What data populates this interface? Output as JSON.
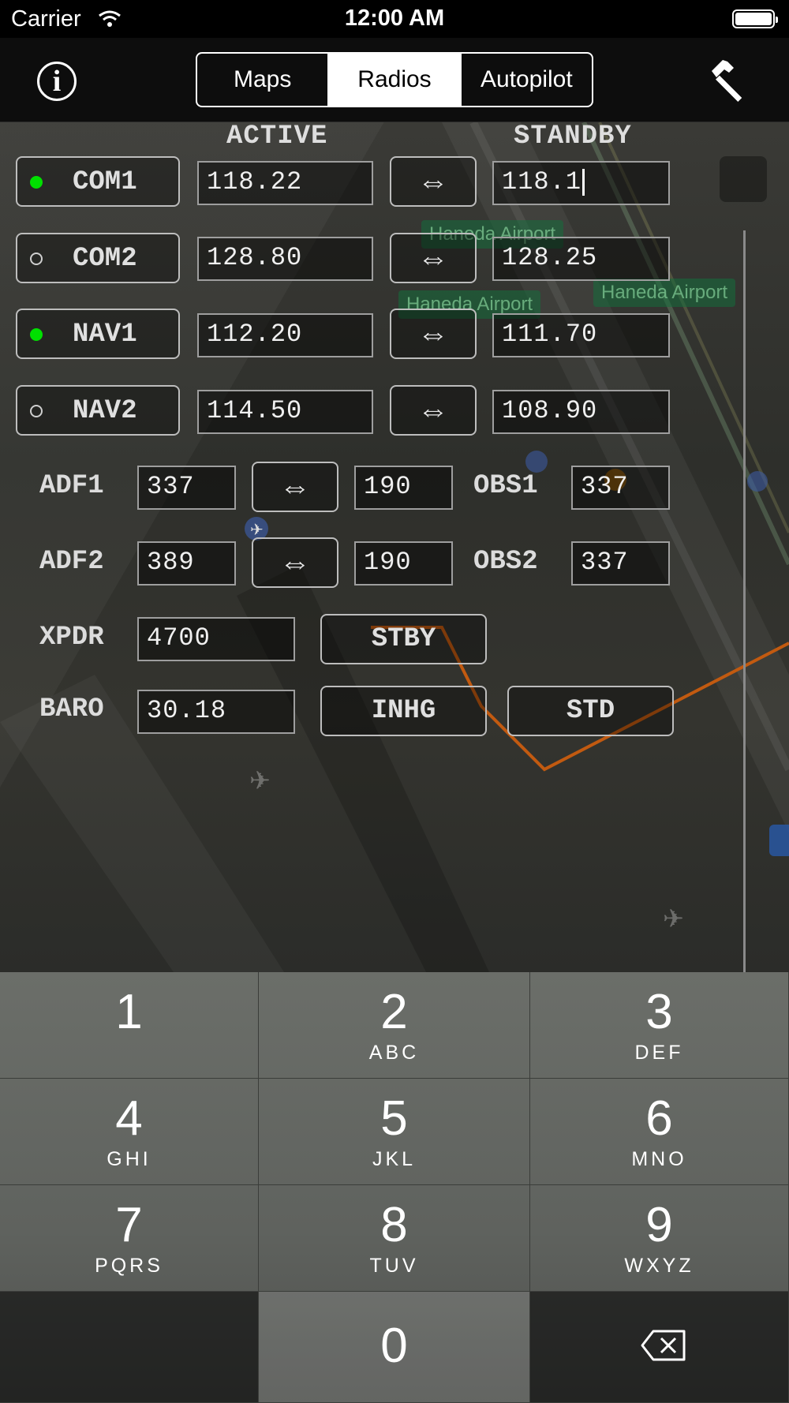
{
  "status_bar": {
    "carrier": "Carrier",
    "time": "12:00 AM"
  },
  "nav": {
    "info_glyph": "i",
    "tabs": [
      {
        "label": "Maps",
        "selected": false
      },
      {
        "label": "Radios",
        "selected": true
      },
      {
        "label": "Autopilot",
        "selected": false
      }
    ]
  },
  "map": {
    "labels": [
      "Haneda Airport",
      "Haneda Airport",
      "Haneda Airport"
    ]
  },
  "radios": {
    "header_active": "ACTIVE",
    "header_standby": "STANDBY",
    "swap_glyph": "⇔",
    "rows": [
      {
        "name": "COM1",
        "selected": true,
        "active": "118.22",
        "standby": "118.1"
      },
      {
        "name": "COM2",
        "selected": false,
        "active": "128.80",
        "standby": "128.25"
      },
      {
        "name": "NAV1",
        "selected": true,
        "active": "112.20",
        "standby": "111.70"
      },
      {
        "name": "NAV2",
        "selected": false,
        "active": "114.50",
        "standby": "108.90"
      }
    ],
    "adf": [
      {
        "name": "ADF1",
        "active": "337",
        "standby": "190",
        "obs_label": "OBS1",
        "obs_value": "337"
      },
      {
        "name": "ADF2",
        "active": "389",
        "standby": "190",
        "obs_label": "OBS2",
        "obs_value": "337"
      }
    ],
    "xpdr": {
      "label": "XPDR",
      "value": "4700",
      "mode_button": "STBY"
    },
    "baro": {
      "label": "BARO",
      "value": "30.18",
      "unit_button": "INHG",
      "std_button": "STD"
    }
  },
  "keypad": {
    "keys": [
      {
        "num": "1",
        "letters": ""
      },
      {
        "num": "2",
        "letters": "ABC"
      },
      {
        "num": "3",
        "letters": "DEF"
      },
      {
        "num": "4",
        "letters": "GHI"
      },
      {
        "num": "5",
        "letters": "JKL"
      },
      {
        "num": "6",
        "letters": "MNO"
      },
      {
        "num": "7",
        "letters": "PQRS"
      },
      {
        "num": "8",
        "letters": "TUV"
      },
      {
        "num": "9",
        "letters": "WXYZ"
      },
      {
        "num": "0",
        "letters": ""
      }
    ]
  }
}
